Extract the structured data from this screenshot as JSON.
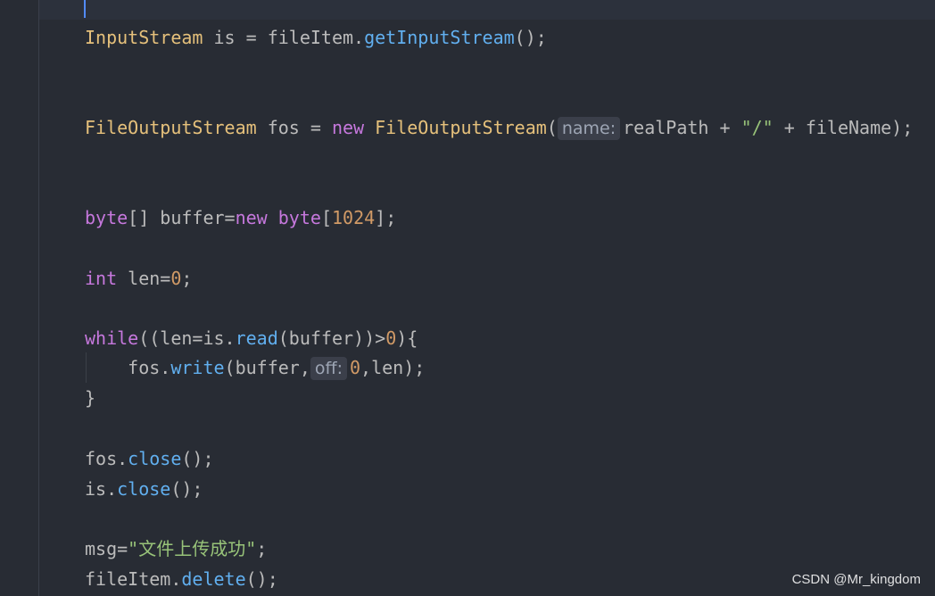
{
  "colors": {
    "background": "#282c34",
    "type": "#e5c07b",
    "method": "#61afef",
    "keyword": "#c678dd",
    "string": "#98c379",
    "number": "#d19a66",
    "text": "#bbbbbb",
    "hint_bg": "#3b3f4a",
    "caret": "#528bff"
  },
  "code": {
    "line1": {
      "type": "InputStream",
      "rest1": " is = fileItem.",
      "method": "getInputStream",
      "rest2": "();"
    },
    "line2": {
      "type1": "FileOutputStream",
      "rest1": " fos = ",
      "kw_new": "new",
      "space": " ",
      "type2": "FileOutputStream",
      "paren": "(",
      "hint": "name:",
      "rest2": "realPath + ",
      "str": "\"/\"",
      "rest3": " + fileName);"
    },
    "line3": {
      "kw_byte": "byte",
      "rest1": "[] buffer=",
      "kw_new": "new",
      "space": " ",
      "kw_byte2": "byte",
      "open": "[",
      "num": "1024",
      "close": "];"
    },
    "line4": {
      "kw_int": "int",
      "rest1": " len=",
      "num": "0",
      "rest2": ";"
    },
    "line5": {
      "kw_while": "while",
      "rest1": "((len=is.",
      "method": "read",
      "rest2": "(buffer))>",
      "num": "0",
      "rest3": "){"
    },
    "line6": {
      "indent": "    fos.",
      "method": "write",
      "rest1": "(buffer,",
      "hint": "off:",
      "num": "0",
      "rest2": ",len);"
    },
    "line7": {
      "text": "}"
    },
    "line8": {
      "rest1": "fos.",
      "method": "close",
      "rest2": "();"
    },
    "line9": {
      "rest1": "is.",
      "method": "close",
      "rest2": "();"
    },
    "line10": {
      "rest1": "msg=",
      "str": "\"文件上传成功\"",
      "rest2": ";"
    },
    "line11": {
      "rest1": "fileItem.",
      "method": "delete",
      "rest2": "();"
    }
  },
  "watermark": "CSDN @Mr_kingdom"
}
